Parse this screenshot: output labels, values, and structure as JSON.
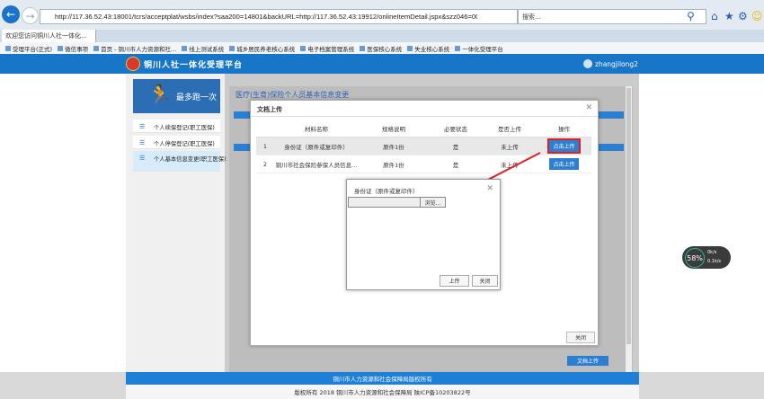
{
  "browser": {
    "url": "http://117.36.52.43:18001/tcrs/acceptplat/wsbs/index?saa200=14801&backURL=http://117.36.52.43:19912/onlineItemDetail.jspx&szz046=00000437&v",
    "search_placeholder": "搜索...",
    "tab_title": "欢迎您访问铜川人社一体化...",
    "favorites": [
      "受理平台(正式)",
      "微信事项",
      "首页 - 铜川市人力资源和社...",
      "线上测试系统",
      "城乡居民养老核心系统",
      "电子档案管理系统",
      "医保核心系统",
      "失业核心系统",
      "一体化受理平台"
    ]
  },
  "app": {
    "title": "铜川人社一体化受理平台",
    "user": "zhangjilong2",
    "promo": "最多跑一次",
    "sidebar": [
      "个人续保登记(职工医保)",
      "个人停保登记(职工医保)",
      "个人基本信息变更(职工医保)"
    ],
    "main_title": "医疗(生育)保险个人员基本信息变更",
    "footer_line1": "铜川市人力资源和社会保障局版权所有",
    "footer_line2": "版权所有 2018 铜川市人力资源和社会保障局 陕ICP备10203822号"
  },
  "upload_dialog": {
    "title": "文档上传",
    "columns": [
      "材料名称",
      "规格说明",
      "必要状态",
      "是否上传",
      "操作"
    ],
    "rows": [
      {
        "no": "1",
        "name": "身份证（原件或复印件）",
        "spec": "原件1份",
        "required": "是",
        "status": "未上传",
        "action": "点击上传"
      },
      {
        "no": "2",
        "name": "铜川市社会保险参保人员信息...",
        "spec": "原件1份",
        "required": "是",
        "status": "未上传",
        "action": "点击上传"
      }
    ],
    "close": "关闭",
    "bottom_button": "文档上传"
  },
  "file_dialog": {
    "title": "身份证（原件或复印件）",
    "browse": "浏览...",
    "upload": "上传",
    "close": "关闭"
  },
  "widget": {
    "percent": "58%",
    "up": "0k/s",
    "down": "0.1k/s"
  },
  "colors": {
    "header_blue": "#1876c8",
    "accent_red": "#e02020"
  }
}
